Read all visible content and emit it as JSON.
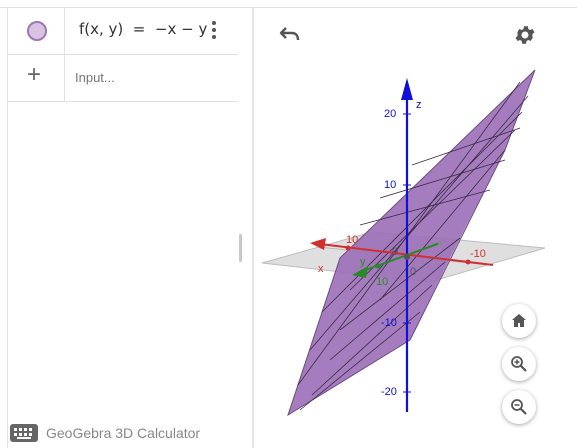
{
  "algebra": {
    "expression": "f(x, y)  =  −x − y",
    "input_placeholder": "Input..."
  },
  "footer": {
    "app_name": "GeoGebra 3D Calculator"
  },
  "graphics": {
    "axis_labels": {
      "z": "z",
      "x": "x",
      "y": "y"
    },
    "z_ticks": [
      "20",
      "10",
      "-10",
      "-20"
    ],
    "x_ticks": [
      "10",
      "-10"
    ],
    "y_ticks": [
      "10"
    ],
    "origin_labels": [
      "0",
      "0"
    ],
    "colors": {
      "plane": "#9b6fb8",
      "x_axis": "#d03030",
      "y_axis": "#2a8a2a",
      "z_axis": "#1010d8"
    }
  },
  "icons": {
    "undo": "undo-icon",
    "settings": "gear-icon",
    "home": "home-icon",
    "zoom_in": "zoom-in-icon",
    "zoom_out": "zoom-out-icon",
    "keyboard": "keyboard-icon",
    "more": "kebab-menu-icon",
    "add": "plus-icon"
  }
}
